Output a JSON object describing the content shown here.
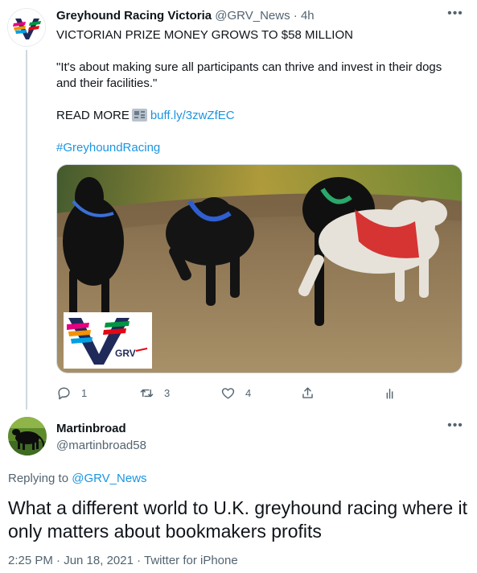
{
  "tweet": {
    "author_name": "Greyhound Racing Victoria",
    "author_handle": "@GRV_News",
    "separator": "·",
    "time": "4h",
    "headline": "VICTORIAN PRIZE MONEY GROWS TO $58 MILLION",
    "quote_line1": "\"It's about making sure all participants can thrive and invest in their dogs",
    "quote_line2": "and their facilities.\"",
    "read_more_label": "READ MORE",
    "link": "buff.ly/3zwZfEC",
    "hashtag": "#GreyhoundRacing",
    "logo_text": "GRV",
    "actions": {
      "reply_count": "1",
      "retweet_count": "3",
      "like_count": "4"
    }
  },
  "reply": {
    "author_name": "Martinbroad",
    "author_handle": "@martinbroad58",
    "replying_prefix": "Replying to",
    "replying_to": "@GRV_News",
    "text": "What a different world to U.K. greyhound racing where it only matters about bookmakers profits",
    "meta": "2:25 PM · Jun 18, 2021 · Twitter for iPhone"
  },
  "icons": [
    "grv-logo-icon",
    "more-icon",
    "newspaper-icon",
    "reply-icon",
    "retweet-icon",
    "like-icon",
    "share-icon",
    "analytics-icon"
  ],
  "colors": {
    "link": "#1b95e0",
    "secondary_text": "#536471",
    "primary_text": "#0f1419",
    "thread_line": "#cfd9de"
  }
}
